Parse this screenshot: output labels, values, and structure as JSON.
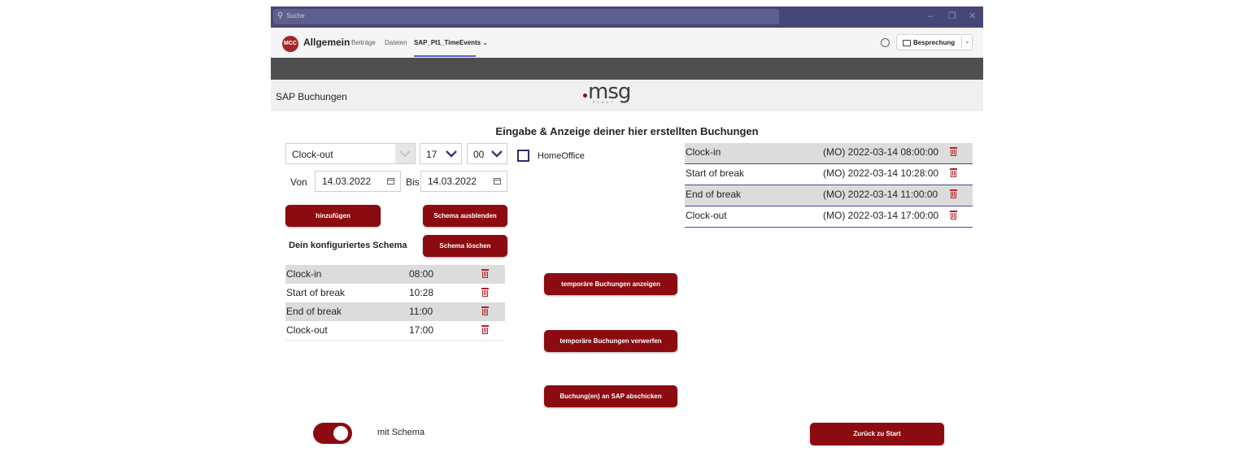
{
  "titlebar": {
    "search_placeholder": "Suche",
    "minimize": "–",
    "maximize": "❐",
    "close": "✕"
  },
  "channel": {
    "avatar_initials": "MCC",
    "title": "Allgemein",
    "tabs": [
      "Beiträge",
      "Dateien",
      "SAP_PI1_TimeEvents ⌄"
    ],
    "meeting_button": "Besprechung",
    "meeting_chevron": "⌄"
  },
  "app_header": {
    "title": "SAP Buchungen",
    "logo_word": "msg",
    "logo_sub": "PLAUT"
  },
  "main_title": "Eingabe & Anzeige deiner hier erstellten Buchungen",
  "form": {
    "event_type": "Clock-out",
    "hour": "17",
    "minute": "00",
    "homeoffice_label": "HomeOffice",
    "from_label": "Von",
    "from_date": "14.03.2022",
    "to_label": "Bis",
    "to_date": "14.03.2022",
    "add_button": "hinzufügen",
    "hide_schema_button": "Schema ausblenden",
    "schema_heading": "Dein konfiguriertes Schema",
    "delete_schema_button": "Schema löschen"
  },
  "schema_rows": [
    {
      "type": "Clock-in",
      "time": "08:00"
    },
    {
      "type": "Start of break",
      "time": "10:28"
    },
    {
      "type": "End of break",
      "time": "11:00"
    },
    {
      "type": "Clock-out",
      "time": "17:00"
    }
  ],
  "bookings": [
    {
      "type": "Clock-in",
      "timestamp": "(MO)  2022-03-14 08:00:00"
    },
    {
      "type": "Start of break",
      "timestamp": "(MO)  2022-03-14 10:28:00"
    },
    {
      "type": "End of break",
      "timestamp": "(MO)  2022-03-14 11:00:00"
    },
    {
      "type": "Clock-out",
      "timestamp": "(MO)  2022-03-14 17:00:00"
    }
  ],
  "actions": {
    "show_temp": "temporäre Buchungen anzeigen",
    "discard_temp": "temporäre Buchungen verwerfen",
    "send_sap": "Buchung(en) an SAP abschicken",
    "back_start": "Zurück zu Start"
  },
  "toggle": {
    "label": "mit Schema",
    "on": true
  },
  "colors": {
    "accent": "#8b0b10",
    "titlebar": "#464775",
    "trash": "#b41f25"
  }
}
